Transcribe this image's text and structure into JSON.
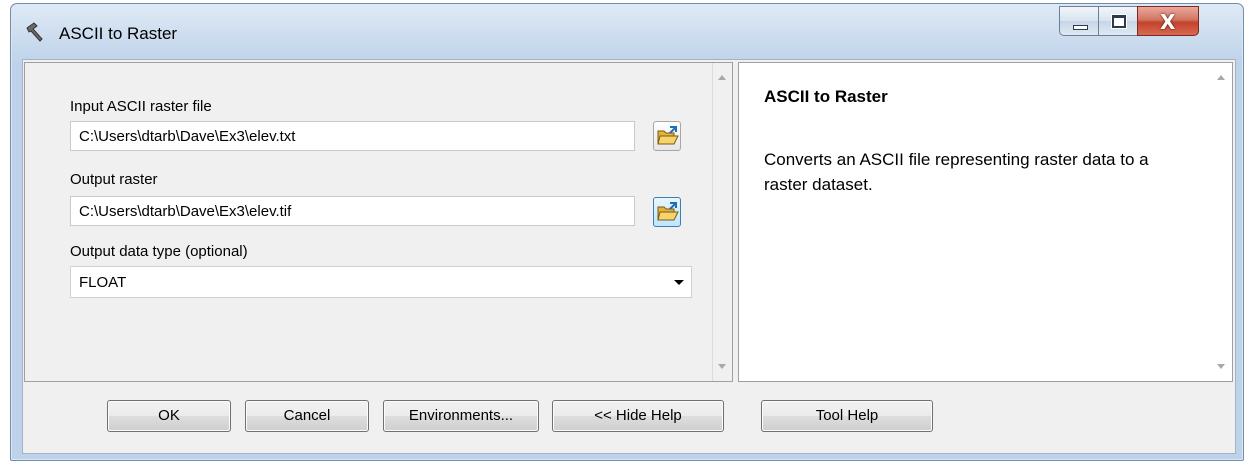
{
  "window": {
    "title": "ASCII to Raster",
    "title_icon": "hammer-icon",
    "controls": {
      "minimize": "minimize-icon",
      "maximize": "maximize-icon",
      "close": "X"
    }
  },
  "form": {
    "input_label": "Input ASCII raster file",
    "input_value": "C:\\Users\\dtarb\\Dave\\Ex3\\elev.txt",
    "output_label": "Output raster",
    "output_value": "C:\\Users\\dtarb\\Dave\\Ex3\\elev.tif",
    "datatype_label": "Output data type (optional)",
    "datatype_value": "FLOAT",
    "browse_icon": "open-folder-icon"
  },
  "help": {
    "title": "ASCII to Raster",
    "description": "Converts an ASCII file representing raster data to a raster dataset."
  },
  "buttons": {
    "ok": "OK",
    "cancel": "Cancel",
    "environments": "Environments...",
    "hide_help": "<< Hide Help",
    "tool_help": "Tool Help"
  },
  "colors": {
    "titlebar": "#c6d8ec",
    "close_button": "#c2432d",
    "dialog_background": "#f0f0f0"
  }
}
